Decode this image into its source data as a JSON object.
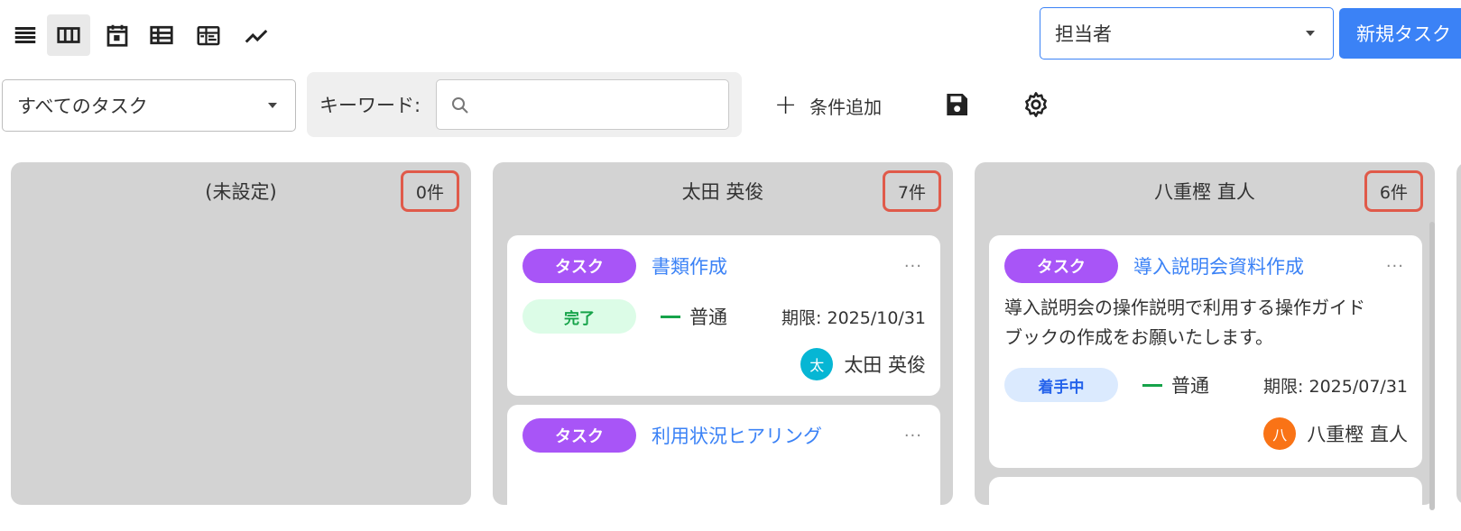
{
  "toolbar": {
    "views": [
      {
        "name": "list-view-icon",
        "active": false
      },
      {
        "name": "kanban-view-icon",
        "active": true
      },
      {
        "name": "calendar-view-icon",
        "active": false
      },
      {
        "name": "table-view-icon",
        "active": false
      },
      {
        "name": "gantt-view-icon",
        "active": false
      },
      {
        "name": "chart-view-icon",
        "active": false
      }
    ],
    "assignee_select": "担当者",
    "new_task_label": "新規タスク"
  },
  "filters": {
    "task_filter": "すべてのタスク",
    "keyword_label": "キーワード:",
    "keyword_value": "",
    "add_condition_label": "条件追加",
    "icons": [
      "save-icon",
      "settings-gear-icon"
    ]
  },
  "colors": {
    "accent": "#3b82f6",
    "type_badge": "#a855f7",
    "count_highlight": "#e05a4a",
    "column_bg": "#d3d3d3"
  },
  "columns": [
    {
      "title": "(未設定)",
      "count": "0件",
      "cards": []
    },
    {
      "title": "太田 英俊",
      "count": "7件",
      "cards": [
        {
          "type": "タスク",
          "title": "書類作成",
          "more": "···",
          "status": "完了",
          "priority": "普通",
          "due": "期限: 2025/10/31",
          "assignee": "太田 英俊",
          "avatar_char": "太",
          "avatar_color": "#06b6d4"
        },
        {
          "type": "タスク",
          "title": "利用状況ヒアリング",
          "more": "···"
        }
      ]
    },
    {
      "title": "八重樫 直人",
      "count": "6件",
      "cards": [
        {
          "type": "タスク",
          "title": "導入説明会資料作成",
          "more": "···",
          "description_line1": "導入説明会の操作説明で利用する操作ガイド",
          "description_line2": "ブックの作成をお願いたします。",
          "status": "着手中",
          "priority": "普通",
          "due": "期限: 2025/07/31",
          "assignee": "八重樫 直人",
          "avatar_char": "八",
          "avatar_color": "#f97316"
        }
      ]
    }
  ]
}
